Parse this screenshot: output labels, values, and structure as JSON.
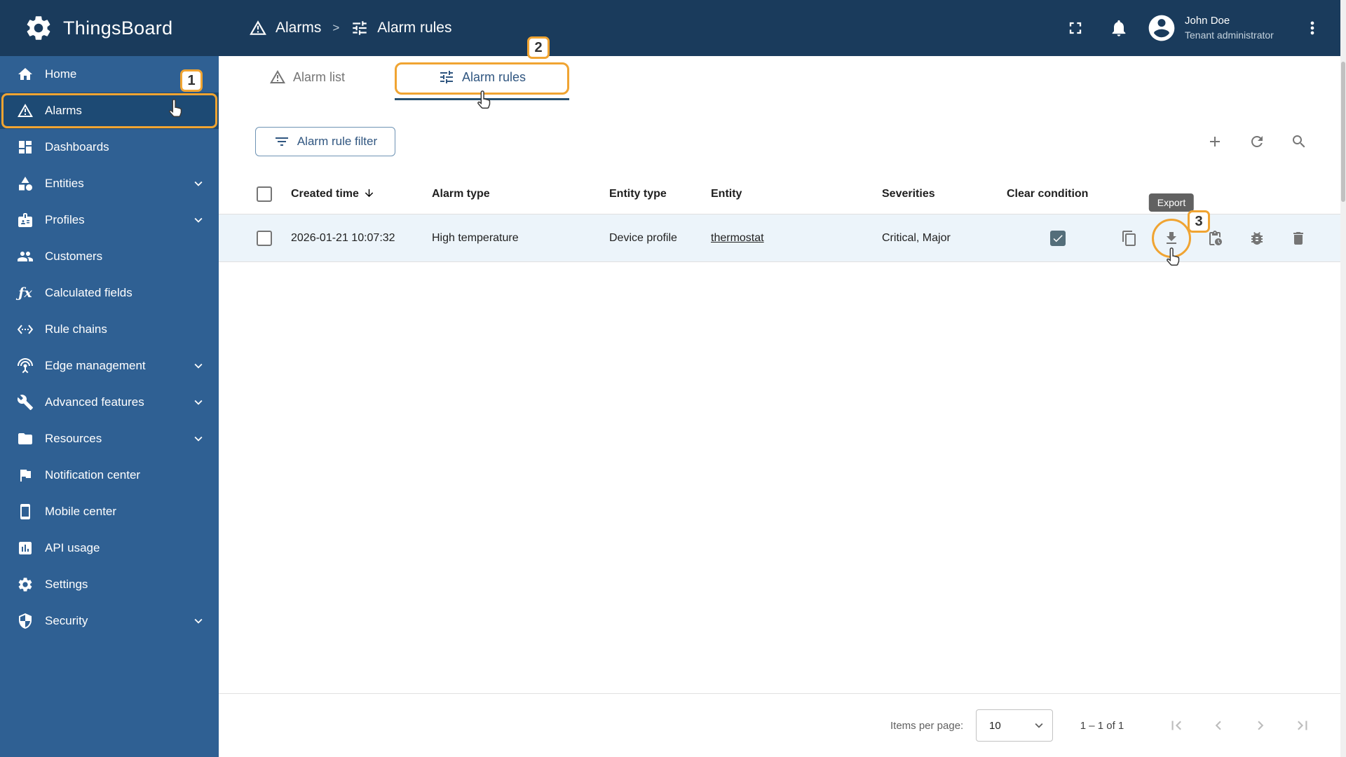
{
  "colors": {
    "header_bg": "#1a3b5c",
    "sidebar_bg": "#2f6093",
    "sidebar_selected_bg": "#1d4a74",
    "primary_blue": "#305680",
    "link_blue": "#2a7cc7",
    "annotation_orange": "#f0a432",
    "row_highlight_bg": "#ecf4fa",
    "tooltip_bg": "#616161"
  },
  "header": {
    "app_title": "ThingsBoard",
    "breadcrumb": {
      "level1": "Alarms",
      "separator": ">",
      "level2": "Alarm rules"
    },
    "user": {
      "name": "John Doe",
      "role": "Tenant administrator"
    }
  },
  "sidebar": {
    "fx_glyph": "ƒx",
    "items": [
      {
        "label": "Home",
        "icon": "home-icon"
      },
      {
        "label": "Alarms",
        "icon": "warning-icon",
        "selected": true
      },
      {
        "label": "Dashboards",
        "icon": "dashboards-icon"
      },
      {
        "label": "Entities",
        "icon": "entities-icon",
        "expandable": true
      },
      {
        "label": "Profiles",
        "icon": "profiles-icon",
        "expandable": true
      },
      {
        "label": "Customers",
        "icon": "customers-icon"
      },
      {
        "label": "Calculated fields",
        "icon": "fx-icon"
      },
      {
        "label": "Rule chains",
        "icon": "rule-chains-icon"
      },
      {
        "label": "Edge management",
        "icon": "edge-antenna-icon",
        "expandable": true
      },
      {
        "label": "Advanced features",
        "icon": "tools-icon",
        "expandable": true
      },
      {
        "label": "Resources",
        "icon": "folder-icon",
        "expandable": true
      },
      {
        "label": "Notification center",
        "icon": "flag-icon"
      },
      {
        "label": "Mobile center",
        "icon": "smartphone-icon"
      },
      {
        "label": "API usage",
        "icon": "chart-icon"
      },
      {
        "label": "Settings",
        "icon": "gear-icon"
      },
      {
        "label": "Security",
        "icon": "shield-icon",
        "expandable": true
      }
    ]
  },
  "tabs": {
    "alarm_list": "Alarm list",
    "alarm_rules": "Alarm rules"
  },
  "toolbar": {
    "filter_button_label": "Alarm rule filter"
  },
  "table": {
    "columns": {
      "created_time": "Created time",
      "alarm_type": "Alarm type",
      "entity_type": "Entity type",
      "entity": "Entity",
      "severities": "Severities",
      "clear_condition": "Clear condition"
    },
    "rows": [
      {
        "created_time": "2026-01-21 10:07:32",
        "alarm_type": "High temperature",
        "entity_type": "Device profile",
        "entity": "thermostat",
        "severities": "Critical, Major",
        "clear_condition": true
      }
    ]
  },
  "tooltip": {
    "export_label": "Export"
  },
  "pagination": {
    "items_per_page_label": "Items per page:",
    "page_size": "10",
    "range": "1 – 1 of 1"
  },
  "annotations": {
    "step_1": "1",
    "step_2": "2",
    "step_3": "3"
  }
}
